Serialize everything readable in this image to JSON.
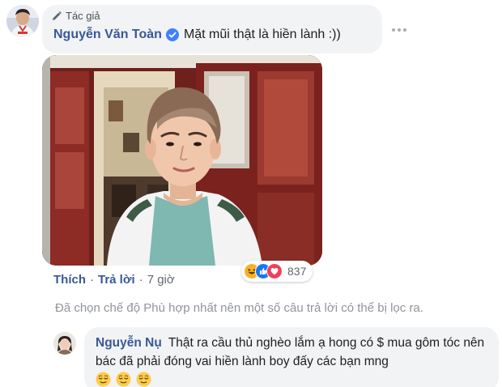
{
  "comment": {
    "author_badge": "Tác giả",
    "author_name": "Nguyễn Văn Toàn",
    "text": "Mặt mũi thật là hiền lành :))",
    "verified": true
  },
  "reactions": {
    "icons": [
      "laugh-reaction-icon",
      "like-reaction-icon",
      "love-reaction-icon"
    ],
    "count": "837"
  },
  "actions": {
    "like": "Thích",
    "reply": "Trả lời",
    "separator": "·",
    "time": "7 giờ"
  },
  "filter_notice": "Đã chọn chế độ Phù hợp nhất nên một số câu trả lời có thể bị lọc ra.",
  "reply": {
    "author_name": "Nguyễn Nụ",
    "text": "Thật ra cầu thủ nghèo lắm ạ hong có $ mua gôm tóc nên bác đã phải đóng vai hiền lành boy đấy các bạn mng",
    "emojis": [
      "relieved-face-emoji",
      "relieved-face-emoji",
      "relieved-face-emoji"
    ]
  },
  "colors": {
    "link": "#385898",
    "bubble": "#f2f3f5",
    "muted": "#90949c",
    "like_blue": "#1877f2",
    "love_red": "#f33e58",
    "haha_yellow": "#f7b125"
  }
}
